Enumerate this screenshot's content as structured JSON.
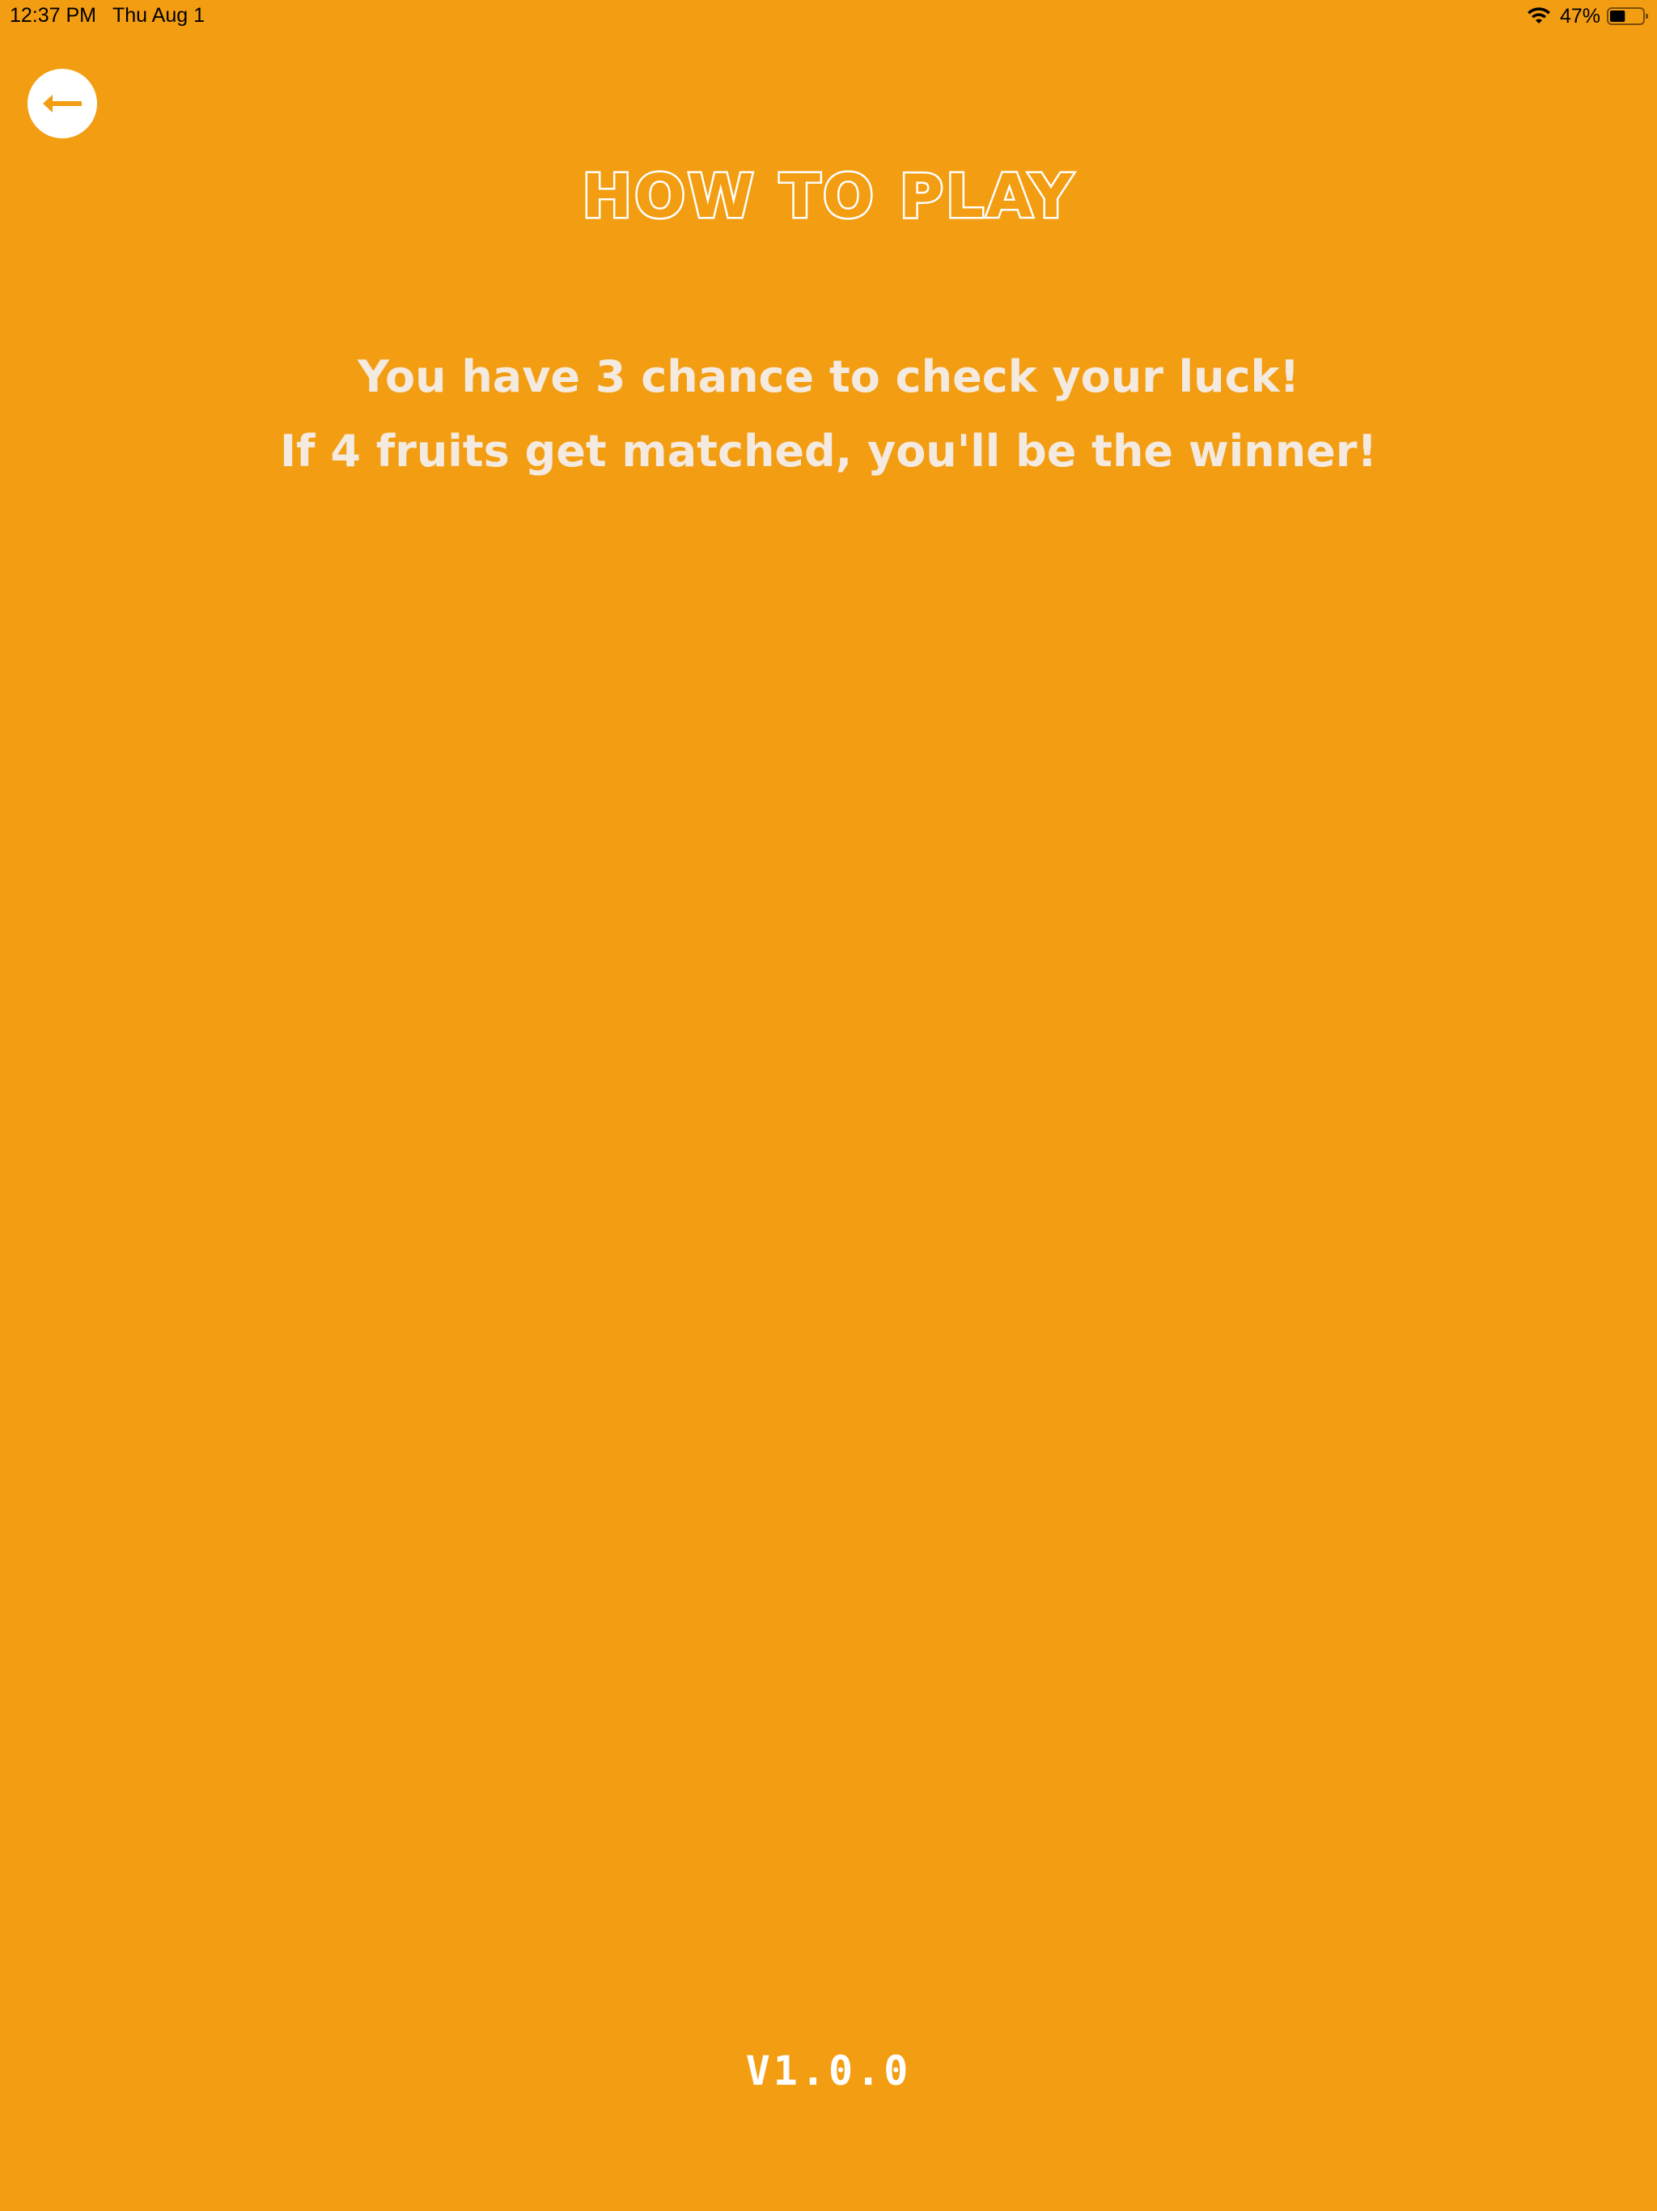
{
  "status_bar": {
    "time": "12:37 PM",
    "date": "Thu Aug 1",
    "battery_percent": "47%",
    "battery_level": 0.47,
    "wifi_icon": "wifi-icon",
    "battery_icon": "battery-icon"
  },
  "nav": {
    "back_icon": "back-arrow-icon"
  },
  "title": "HOW TO PLAY",
  "instructions": [
    "You have 3 chance to check your luck!",
    "If 4 fruits get matched, you'll be the winner!"
  ],
  "version": "V1.0.0",
  "colors": {
    "background": "#F39D12",
    "accent": "#FFFFFF",
    "text": "#F4EAE0"
  }
}
